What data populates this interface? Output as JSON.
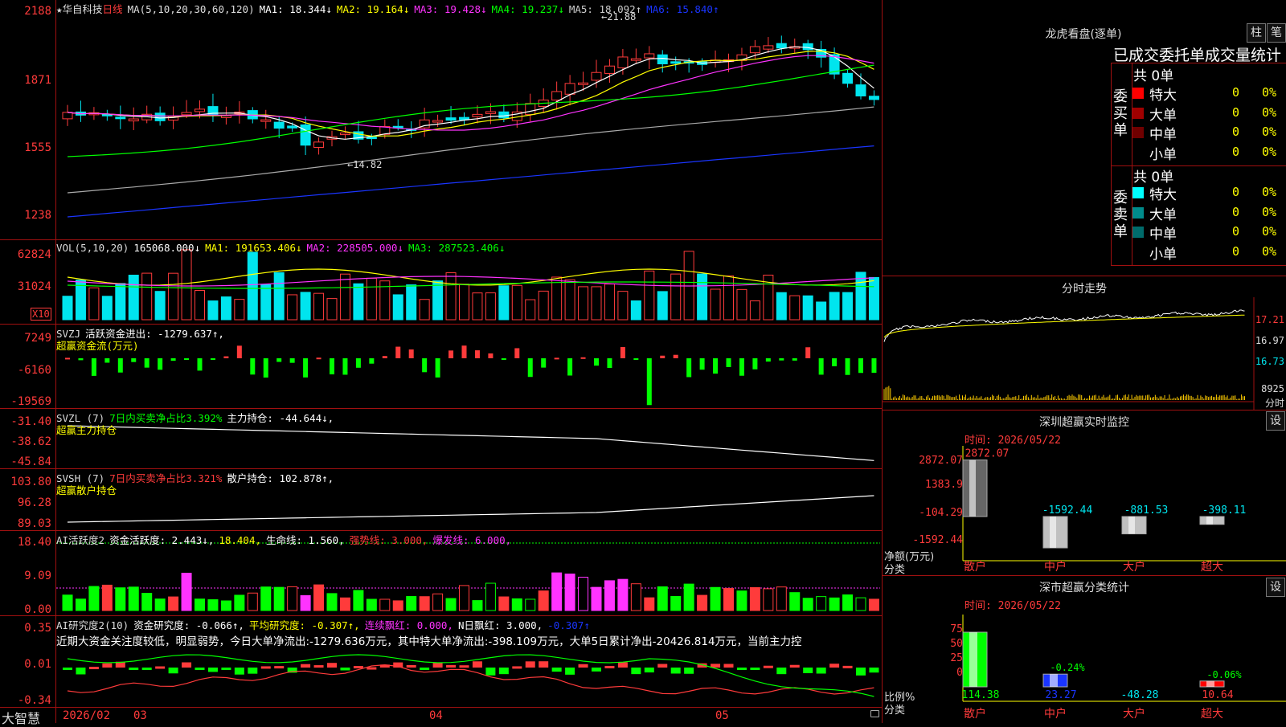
{
  "stock": {
    "star": "★",
    "name": "华自科技",
    "period": "日线"
  },
  "colors": {
    "up": "#ff3b3b",
    "down": "#00e5ee",
    "grid": "#a01010",
    "yellow": "#ffff00",
    "magenta": "#ff33ff",
    "green": "#00ff00",
    "blue": "#1a35ff",
    "gray": "#aaaaaa"
  },
  "price_panel": {
    "ma_label": "MA(5,10,20,30,60,120)",
    "ma1": "MA1: 18.344↓",
    "ma2": "MA2: 19.164↓",
    "ma3": "MA3: 19.428↓",
    "ma4": "MA4: 19.237↓",
    "ma5": "MA5: 18.092↑",
    "ma6": "MA6: 15.840↑",
    "y_labels": [
      "2188",
      "1871",
      "1555",
      "1238"
    ],
    "high_marker": "21.88",
    "low_marker": "14.82"
  },
  "vol_panel": {
    "label": "VOL(5,10,20)",
    "value": "165068.000↓",
    "ma1": "MA1: 191653.406↓",
    "ma2": "MA2: 228505.000↓",
    "ma3": "MA3: 287523.406↓",
    "y_labels": [
      "62824",
      "31024"
    ],
    "unit": "X10"
  },
  "svzj_panel": {
    "label": "SVZJ",
    "text": "活跃资金进出: -1279.637↑,",
    "subtitle": "超赢资金流(万元)",
    "y_labels": [
      "7249",
      "-6160",
      "-19569"
    ]
  },
  "svzl_panel": {
    "label": "SVZL (7)",
    "text1": "7日内买卖净占比3.392%",
    "text2": "主力持仓: -44.644↓,",
    "subtitle": "超赢主力持仓",
    "y_labels": [
      "-31.40",
      "-38.62",
      "-45.84"
    ]
  },
  "svsh_panel": {
    "label": "SVSH (7)",
    "text1": "7日内买卖净占比3.321%",
    "text2": "散户持仓: 102.878↑,",
    "subtitle": "超赢散户持仓",
    "y_labels": [
      "103.80",
      "96.28",
      "89.03"
    ]
  },
  "ai_active_panel": {
    "label": "AI活跃度2",
    "t1": "资金活跃度: 2.443↓,",
    "t2": "18.404,",
    "t3": "生命线: 1.560,",
    "t4": "强势线: 3.000,",
    "t5": "爆发线: 6.000,",
    "y_labels": [
      "18.40",
      "9.09",
      "0.00"
    ]
  },
  "ai_research_panel": {
    "label": "AI研究度2(10)",
    "t1": "资金研究度: -0.066↑,",
    "t2": "平均研究度: -0.307↑,",
    "t3": "连续飘红: 0.000,",
    "t4": "N日飘红: 3.000,",
    "t5": "-0.307↑",
    "comment": "近期大资金关注度较低，明显弱势，今日大单净流出:-1279.636万元，其中特大单净流出:-398.109万元，大单5日累计净出-20426.814万元，当前主力控",
    "y_labels": [
      "0.35",
      "0.01",
      "-0.34"
    ]
  },
  "bottom_axis": {
    "brand": "大智慧",
    "labels": [
      "2026/02",
      "03",
      "04",
      "05"
    ]
  },
  "dragon_tiger": {
    "title": "龙虎看盘(逐单)",
    "btn1": "柱",
    "btn2": "笔",
    "tabs": "已成交委托单成交量统计",
    "buy_label": "委买单",
    "sell_label": "委卖单",
    "buy_total": "共 0单",
    "sell_total": "共 0单",
    "buy_rows": [
      {
        "name": "特大",
        "count": "0",
        "pct": "0%",
        "color": "#ff0000"
      },
      {
        "name": "大单",
        "count": "0",
        "pct": "0%",
        "color": "#a00000"
      },
      {
        "name": "中单",
        "count": "0",
        "pct": "0%",
        "color": "#700000"
      },
      {
        "name": "小单",
        "count": "0",
        "pct": "0%",
        "color": "#000000"
      }
    ],
    "sell_rows": [
      {
        "name": "特大",
        "count": "0",
        "pct": "0%",
        "color": "#00ffff"
      },
      {
        "name": "大单",
        "count": "0",
        "pct": "0%",
        "color": "#008b8b"
      },
      {
        "name": "中单",
        "count": "0",
        "pct": "0%",
        "color": "#006b6b"
      },
      {
        "name": "小单",
        "count": "0",
        "pct": "0%",
        "color": "#000000"
      }
    ]
  },
  "intraday": {
    "title": "分时走势",
    "y_labels": [
      "17.21",
      "16.97",
      "16.73"
    ],
    "vol_label": "8925",
    "vol_unit": "分时"
  },
  "sz_monitor": {
    "title": "深圳超赢实时监控",
    "btn": "设",
    "time": "时间: 2026/05/22",
    "y_labels": [
      "2872.07",
      "1383.9",
      "-104.29",
      "-1592.44"
    ],
    "ylabel1": "净额(万元)",
    "ylabel2": "分类",
    "chart_data": {
      "type": "bar",
      "categories": [
        "散户",
        "中户",
        "大户",
        "超大"
      ],
      "values": [
        2872.07,
        -1592.44,
        -881.53,
        -398.11
      ],
      "value_labels": [
        "2872.07",
        "-1592.44",
        "-881.53",
        "-398.11"
      ],
      "ylim": [
        -1592.44,
        2872.07
      ]
    }
  },
  "sz_class": {
    "title": "深市超赢分类统计",
    "btn": "设",
    "time": "时间: 2026/05/22",
    "y_labels": [
      "75",
      "50",
      "25",
      "0"
    ],
    "ylabel1": "比例%",
    "ylabel2": "分类",
    "chart_data": {
      "type": "bar",
      "categories": [
        "散户",
        "中户",
        "大户",
        "超大"
      ],
      "values": [
        114.38,
        23.27,
        -48.28,
        10.64
      ],
      "value_labels": [
        "114.38",
        "23.27",
        "-48.28",
        "10.64"
      ],
      "bar_labels": [
        "",
        "-0.24%",
        "",
        "-0.06%"
      ],
      "ylim": [
        0,
        100
      ]
    }
  }
}
